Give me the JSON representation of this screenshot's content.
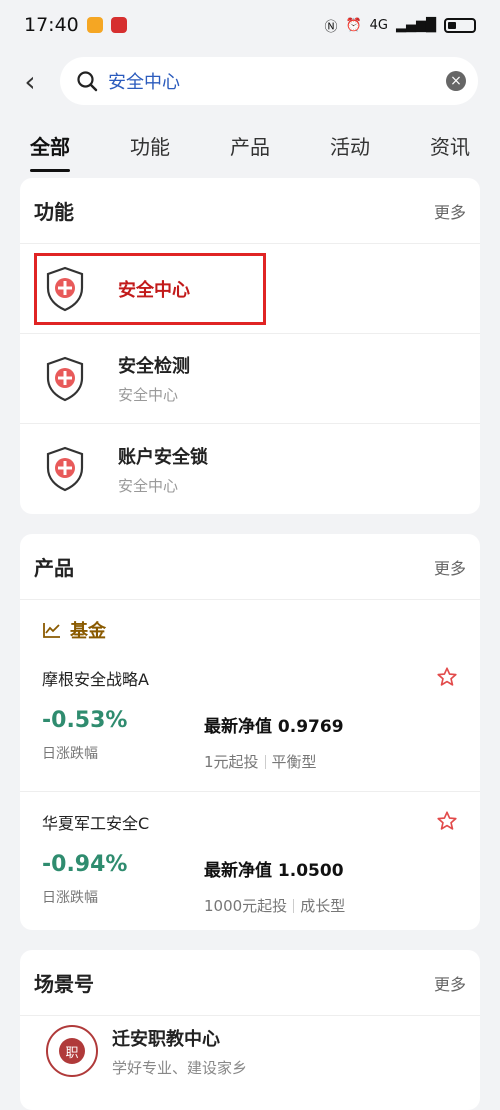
{
  "status": {
    "time": "17:40",
    "network": "4G"
  },
  "search": {
    "query": "安全中心"
  },
  "tabs": [
    {
      "label": "全部",
      "active": true
    },
    {
      "label": "功能"
    },
    {
      "label": "产品"
    },
    {
      "label": "活动"
    },
    {
      "label": "资讯"
    }
  ],
  "features": {
    "title": "功能",
    "more": "更多",
    "items": [
      {
        "title": "安全中心",
        "subtitle": ""
      },
      {
        "title": "安全检测",
        "subtitle": "安全中心"
      },
      {
        "title": "账户安全锁",
        "subtitle": "安全中心"
      }
    ]
  },
  "products": {
    "title": "产品",
    "more": "更多",
    "category": "基金",
    "funds": [
      {
        "name": "摩根安全战略A",
        "change": "-0.53%",
        "change_label": "日涨跌幅",
        "nav": "最新净值 0.9769",
        "min": "1元起投",
        "type": "平衡型"
      },
      {
        "name": "华夏军工安全C",
        "change": "-0.94%",
        "change_label": "日涨跌幅",
        "nav": "最新净值 1.0500",
        "min": "1000元起投",
        "type": "成长型"
      }
    ]
  },
  "scenes": {
    "title": "场景号",
    "more": "更多",
    "items": [
      {
        "name": "迁安职教中心",
        "desc": "学好专业、建设家乡",
        "seal_char": "职"
      }
    ]
  },
  "colors": {
    "accent_red": "#e02424",
    "green": "#2f8c6f",
    "gold": "#8a5a00"
  }
}
